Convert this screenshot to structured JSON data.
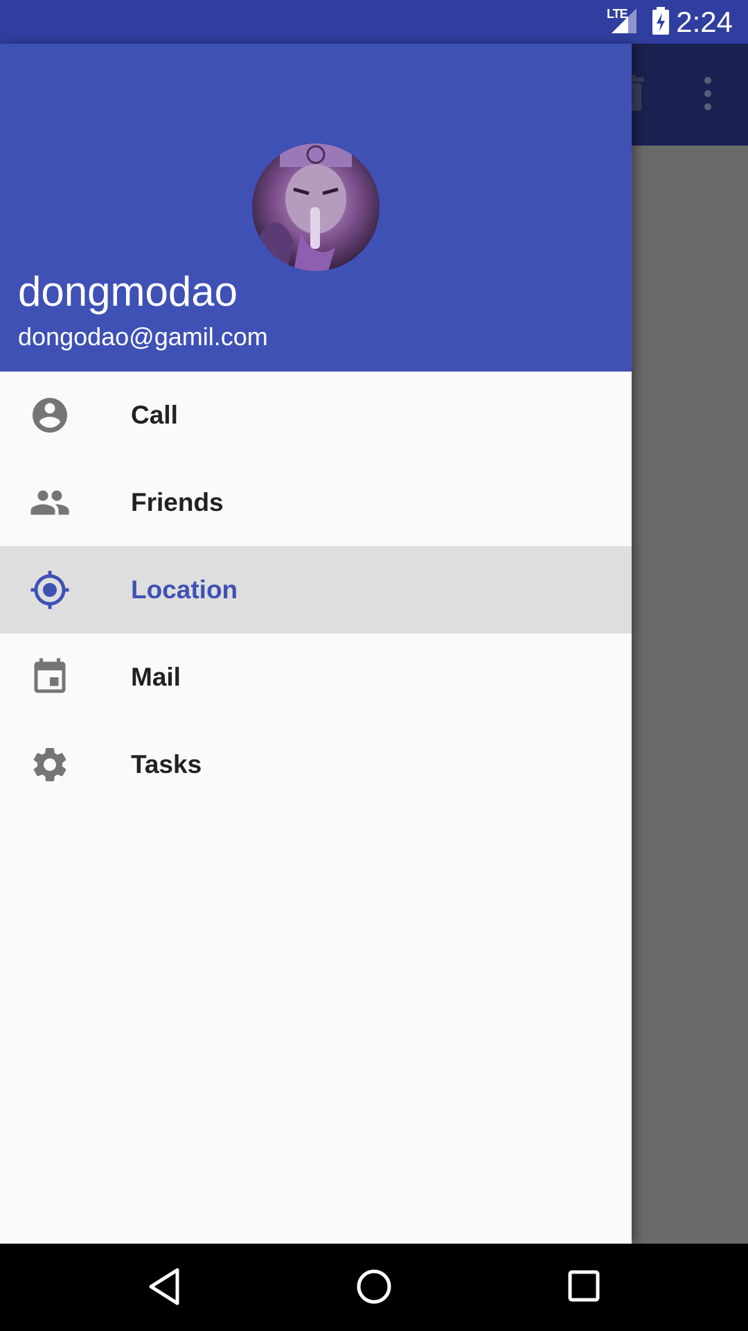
{
  "status_bar": {
    "time": "2:24",
    "network": "LTE",
    "icons": [
      "lte-signal-icon",
      "battery-charging-icon"
    ]
  },
  "toolbar": {
    "icons": [
      "trash-icon",
      "more-vert-icon"
    ]
  },
  "drawer": {
    "header": {
      "name": "dongmodao",
      "email": "dongodao@gamil.com",
      "avatar_icon": "avatar"
    },
    "items": [
      {
        "label": "Call",
        "icon": "account-circle-icon",
        "active": false
      },
      {
        "label": "Friends",
        "icon": "group-icon",
        "active": false
      },
      {
        "label": "Location",
        "icon": "my-location-icon",
        "active": true
      },
      {
        "label": "Mail",
        "icon": "calendar-icon",
        "active": false
      },
      {
        "label": "Tasks",
        "icon": "gear-icon",
        "active": false
      }
    ]
  },
  "colors": {
    "primary": "#3f51b5",
    "primary_dark": "#303f9f",
    "active_row": "#dedede",
    "icon_gray": "#757575"
  },
  "nav_bar": {
    "icons": [
      "back-icon",
      "home-icon",
      "recents-icon"
    ]
  }
}
